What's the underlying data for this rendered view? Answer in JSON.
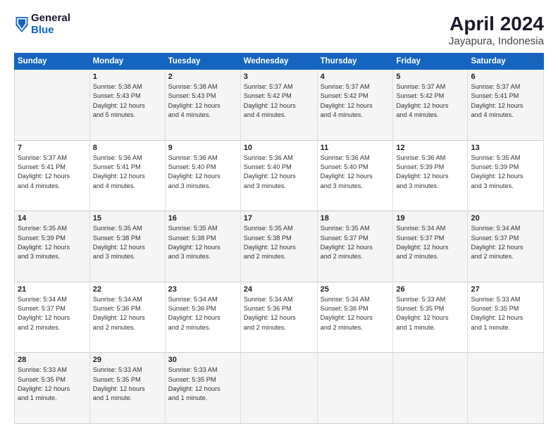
{
  "header": {
    "logo_general": "General",
    "logo_blue": "Blue",
    "title": "April 2024",
    "subtitle": "Jayapura, Indonesia"
  },
  "days_of_week": [
    "Sunday",
    "Monday",
    "Tuesday",
    "Wednesday",
    "Thursday",
    "Friday",
    "Saturday"
  ],
  "weeks": [
    [
      {
        "day": "",
        "text": ""
      },
      {
        "day": "1",
        "text": "Sunrise: 5:38 AM\nSunset: 5:43 PM\nDaylight: 12 hours\nand 5 minutes."
      },
      {
        "day": "2",
        "text": "Sunrise: 5:38 AM\nSunset: 5:43 PM\nDaylight: 12 hours\nand 4 minutes."
      },
      {
        "day": "3",
        "text": "Sunrise: 5:37 AM\nSunset: 5:42 PM\nDaylight: 12 hours\nand 4 minutes."
      },
      {
        "day": "4",
        "text": "Sunrise: 5:37 AM\nSunset: 5:42 PM\nDaylight: 12 hours\nand 4 minutes."
      },
      {
        "day": "5",
        "text": "Sunrise: 5:37 AM\nSunset: 5:42 PM\nDaylight: 12 hours\nand 4 minutes."
      },
      {
        "day": "6",
        "text": "Sunrise: 5:37 AM\nSunset: 5:41 PM\nDaylight: 12 hours\nand 4 minutes."
      }
    ],
    [
      {
        "day": "7",
        "text": "Sunrise: 5:37 AM\nSunset: 5:41 PM\nDaylight: 12 hours\nand 4 minutes."
      },
      {
        "day": "8",
        "text": "Sunrise: 5:36 AM\nSunset: 5:41 PM\nDaylight: 12 hours\nand 4 minutes."
      },
      {
        "day": "9",
        "text": "Sunrise: 5:36 AM\nSunset: 5:40 PM\nDaylight: 12 hours\nand 3 minutes."
      },
      {
        "day": "10",
        "text": "Sunrise: 5:36 AM\nSunset: 5:40 PM\nDaylight: 12 hours\nand 3 minutes."
      },
      {
        "day": "11",
        "text": "Sunrise: 5:36 AM\nSunset: 5:40 PM\nDaylight: 12 hours\nand 3 minutes."
      },
      {
        "day": "12",
        "text": "Sunrise: 5:36 AM\nSunset: 5:39 PM\nDaylight: 12 hours\nand 3 minutes."
      },
      {
        "day": "13",
        "text": "Sunrise: 5:35 AM\nSunset: 5:39 PM\nDaylight: 12 hours\nand 3 minutes."
      }
    ],
    [
      {
        "day": "14",
        "text": "Sunrise: 5:35 AM\nSunset: 5:39 PM\nDaylight: 12 hours\nand 3 minutes."
      },
      {
        "day": "15",
        "text": "Sunrise: 5:35 AM\nSunset: 5:38 PM\nDaylight: 12 hours\nand 3 minutes."
      },
      {
        "day": "16",
        "text": "Sunrise: 5:35 AM\nSunset: 5:38 PM\nDaylight: 12 hours\nand 3 minutes."
      },
      {
        "day": "17",
        "text": "Sunrise: 5:35 AM\nSunset: 5:38 PM\nDaylight: 12 hours\nand 2 minutes."
      },
      {
        "day": "18",
        "text": "Sunrise: 5:35 AM\nSunset: 5:37 PM\nDaylight: 12 hours\nand 2 minutes."
      },
      {
        "day": "19",
        "text": "Sunrise: 5:34 AM\nSunset: 5:37 PM\nDaylight: 12 hours\nand 2 minutes."
      },
      {
        "day": "20",
        "text": "Sunrise: 5:34 AM\nSunset: 5:37 PM\nDaylight: 12 hours\nand 2 minutes."
      }
    ],
    [
      {
        "day": "21",
        "text": "Sunrise: 5:34 AM\nSunset: 5:37 PM\nDaylight: 12 hours\nand 2 minutes."
      },
      {
        "day": "22",
        "text": "Sunrise: 5:34 AM\nSunset: 5:36 PM\nDaylight: 12 hours\nand 2 minutes."
      },
      {
        "day": "23",
        "text": "Sunrise: 5:34 AM\nSunset: 5:36 PM\nDaylight: 12 hours\nand 2 minutes."
      },
      {
        "day": "24",
        "text": "Sunrise: 5:34 AM\nSunset: 5:36 PM\nDaylight: 12 hours\nand 2 minutes."
      },
      {
        "day": "25",
        "text": "Sunrise: 5:34 AM\nSunset: 5:36 PM\nDaylight: 12 hours\nand 2 minutes."
      },
      {
        "day": "26",
        "text": "Sunrise: 5:33 AM\nSunset: 5:35 PM\nDaylight: 12 hours\nand 1 minute."
      },
      {
        "day": "27",
        "text": "Sunrise: 5:33 AM\nSunset: 5:35 PM\nDaylight: 12 hours\nand 1 minute."
      }
    ],
    [
      {
        "day": "28",
        "text": "Sunrise: 5:33 AM\nSunset: 5:35 PM\nDaylight: 12 hours\nand 1 minute."
      },
      {
        "day": "29",
        "text": "Sunrise: 5:33 AM\nSunset: 5:35 PM\nDaylight: 12 hours\nand 1 minute."
      },
      {
        "day": "30",
        "text": "Sunrise: 5:33 AM\nSunset: 5:35 PM\nDaylight: 12 hours\nand 1 minute."
      },
      {
        "day": "",
        "text": ""
      },
      {
        "day": "",
        "text": ""
      },
      {
        "day": "",
        "text": ""
      },
      {
        "day": "",
        "text": ""
      }
    ]
  ]
}
